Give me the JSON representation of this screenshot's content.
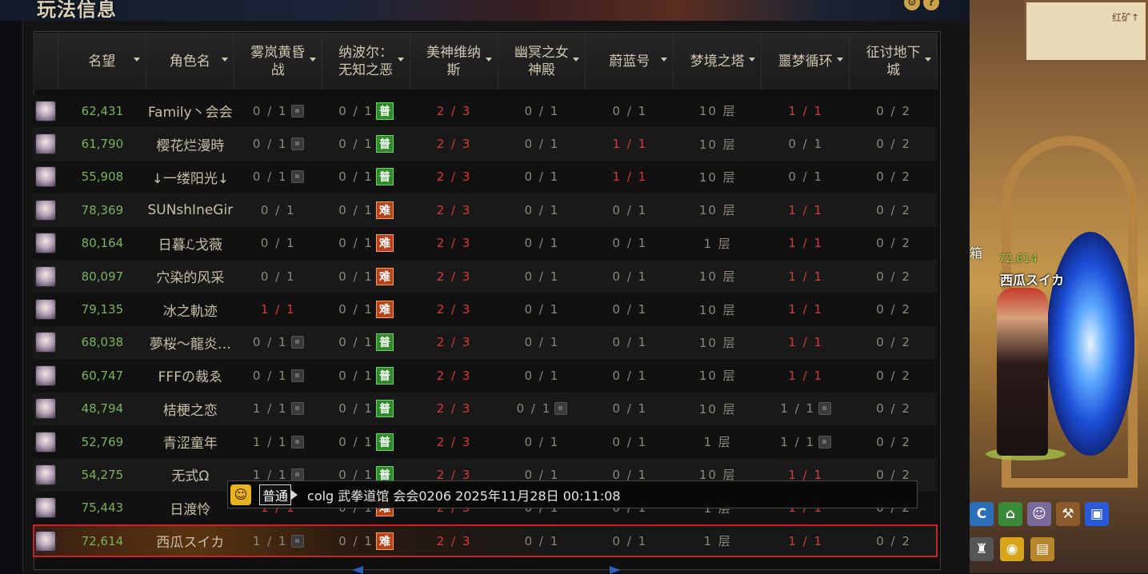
{
  "panel": {
    "title": "玩法信息"
  },
  "header": {
    "columns": [
      {
        "label": "名望"
      },
      {
        "label": "角色名"
      },
      {
        "label": "雾岚黄昏战"
      },
      {
        "label": "纳波尔：无知之恶"
      },
      {
        "label": "美神维纳斯"
      },
      {
        "label": "幽冥之女神殿"
      },
      {
        "label": "蔚蓝号"
      },
      {
        "label": "梦境之塔"
      },
      {
        "label": "噩梦循环"
      },
      {
        "label": "征讨地下城"
      }
    ]
  },
  "badges": {
    "normal": "普",
    "hard": "难"
  },
  "rows": [
    {
      "fame": "62,431",
      "name": "Family丶会会",
      "c1": "0 / 1",
      "c1_lock": true,
      "c2": "0 / 1",
      "c2_badge": "normal",
      "c3": "2 / 3",
      "c3_red": true,
      "c4": "0 / 1",
      "c4_lock": false,
      "c5": "0 / 1",
      "c5_red": false,
      "c6": "10 层",
      "c7": "1 / 1",
      "c7_red": true,
      "c7_lock": false,
      "c8": "0 / 2"
    },
    {
      "fame": "61,790",
      "name": "樱花烂漫時",
      "c1": "0 / 1",
      "c1_lock": true,
      "c2": "0 / 1",
      "c2_badge": "normal",
      "c3": "2 / 3",
      "c3_red": true,
      "c4": "0 / 1",
      "c4_lock": false,
      "c5": "1 / 1",
      "c5_red": true,
      "c6": "10 层",
      "c7": "0 / 1",
      "c7_red": false,
      "c7_lock": false,
      "c8": "0 / 2"
    },
    {
      "fame": "55,908",
      "name": "↓一缕阳光↓",
      "c1": "0 / 1",
      "c1_lock": true,
      "c2": "0 / 1",
      "c2_badge": "normal",
      "c3": "2 / 3",
      "c3_red": true,
      "c4": "0 / 1",
      "c4_lock": false,
      "c5": "1 / 1",
      "c5_red": true,
      "c6": "10 层",
      "c7": "0 / 1",
      "c7_red": false,
      "c7_lock": false,
      "c8": "0 / 2"
    },
    {
      "fame": "78,369",
      "name": "SUNshⅠneGir",
      "c1": "0 / 1",
      "c1_lock": false,
      "c2": "0 / 1",
      "c2_badge": "hard",
      "c3": "2 / 3",
      "c3_red": true,
      "c4": "0 / 1",
      "c4_lock": false,
      "c5": "0 / 1",
      "c5_red": false,
      "c6": "10 层",
      "c7": "1 / 1",
      "c7_red": true,
      "c7_lock": false,
      "c8": "0 / 2"
    },
    {
      "fame": "80,164",
      "name": "日暮ℒ戈薇",
      "c1": "0 / 1",
      "c1_lock": false,
      "c2": "0 / 1",
      "c2_badge": "hard",
      "c3": "2 / 3",
      "c3_red": true,
      "c4": "0 / 1",
      "c4_lock": false,
      "c5": "0 / 1",
      "c5_red": false,
      "c6": "1 层",
      "c7": "1 / 1",
      "c7_red": true,
      "c7_lock": false,
      "c8": "0 / 2"
    },
    {
      "fame": "80,097",
      "name": "穴染的风采",
      "c1": "0 / 1",
      "c1_lock": false,
      "c2": "0 / 1",
      "c2_badge": "hard",
      "c3": "2 / 3",
      "c3_red": true,
      "c4": "0 / 1",
      "c4_lock": false,
      "c5": "0 / 1",
      "c5_red": false,
      "c6": "10 层",
      "c7": "1 / 1",
      "c7_red": true,
      "c7_lock": false,
      "c8": "0 / 2"
    },
    {
      "fame": "79,135",
      "name": "冰之軌迹",
      "c1": "1 / 1",
      "c1_lock": false,
      "c1_red": true,
      "c2": "0 / 1",
      "c2_badge": "hard",
      "c3": "2 / 3",
      "c3_red": true,
      "c4": "0 / 1",
      "c4_lock": false,
      "c5": "0 / 1",
      "c5_red": false,
      "c6": "10 层",
      "c7": "1 / 1",
      "c7_red": true,
      "c7_lock": false,
      "c8": "0 / 2"
    },
    {
      "fame": "68,038",
      "name": "夢桜～龍炎…",
      "c1": "0 / 1",
      "c1_lock": true,
      "c2": "0 / 1",
      "c2_badge": "normal",
      "c3": "2 / 3",
      "c3_red": true,
      "c4": "0 / 1",
      "c4_lock": false,
      "c5": "0 / 1",
      "c5_red": false,
      "c6": "10 层",
      "c7": "1 / 1",
      "c7_red": true,
      "c7_lock": false,
      "c8": "0 / 2"
    },
    {
      "fame": "60,747",
      "name": "FFFの裁ゑ",
      "c1": "0 / 1",
      "c1_lock": true,
      "c2": "0 / 1",
      "c2_badge": "normal",
      "c3": "2 / 3",
      "c3_red": true,
      "c4": "0 / 1",
      "c4_lock": false,
      "c5": "0 / 1",
      "c5_red": false,
      "c6": "10 层",
      "c7": "1 / 1",
      "c7_red": true,
      "c7_lock": false,
      "c8": "0 / 2"
    },
    {
      "fame": "48,794",
      "name": "桔梗之恋",
      "c1": "1 / 1",
      "c1_lock": true,
      "c2": "0 / 1",
      "c2_badge": "normal",
      "c3": "2 / 3",
      "c3_red": true,
      "c4": "0 / 1",
      "c4_lock": true,
      "c5": "0 / 1",
      "c5_red": false,
      "c6": "10 层",
      "c7": "1 / 1",
      "c7_red": false,
      "c7_lock": true,
      "c8": "0 / 2"
    },
    {
      "fame": "52,769",
      "name": "青涩童年",
      "c1": "1 / 1",
      "c1_lock": true,
      "c2": "0 / 1",
      "c2_badge": "normal",
      "c3": "2 / 3",
      "c3_red": true,
      "c4": "0 / 1",
      "c4_lock": false,
      "c5": "0 / 1",
      "c5_red": false,
      "c6": "1 层",
      "c7": "1 / 1",
      "c7_red": false,
      "c7_lock": true,
      "c8": "0 / 2"
    },
    {
      "fame": "54,275",
      "name": "无式Ω",
      "c1": "1 / 1",
      "c1_lock": true,
      "c2": "0 / 1",
      "c2_badge": "normal",
      "c3": "2 / 3",
      "c3_red": true,
      "c4": "0 / 1",
      "c4_lock": false,
      "c5": "0 / 1",
      "c5_red": false,
      "c6": "10 层",
      "c7": "1 / 1",
      "c7_red": true,
      "c7_lock": false,
      "c8": "0 / 2"
    },
    {
      "fame": "75,443",
      "name": "日渡怜",
      "c1": "1 / 1",
      "c1_lock": false,
      "c1_red": true,
      "c2": "0 / 1",
      "c2_badge": "hard",
      "c3": "2 / 3",
      "c3_red": true,
      "c4": "0 / 1",
      "c4_lock": false,
      "c5": "0 / 1",
      "c5_red": false,
      "c6": "1 层",
      "c7": "1 / 1",
      "c7_red": true,
      "c7_lock": false,
      "c8": "0 / 2"
    },
    {
      "fame": "72,614",
      "name": "西瓜スイカ",
      "c1": "1 / 1",
      "c1_lock": true,
      "c2": "0 / 1",
      "c2_badge": "hard",
      "c3": "2 / 3",
      "c3_red": true,
      "c4": "0 / 1",
      "c4_lock": false,
      "c5": "0 / 1",
      "c5_red": false,
      "c6": "1 层",
      "c7": "1 / 1",
      "c7_red": true,
      "c7_lock": false,
      "c8": "0 / 2",
      "selected": true
    }
  ],
  "chat": {
    "emote": "☺",
    "channel": "普通",
    "text": "colg 武拳道馆 会会0206 2025年11月28日 00:11:08"
  },
  "scene": {
    "panel_text": "红矿↑",
    "side_text": "箱",
    "char_fame": "72,614",
    "char_name": "西瓜スイカ",
    "toolbar": [
      "C",
      "⌂",
      "☺",
      "⚒",
      "▣"
    ],
    "toolbar2": [
      "♜",
      "◉",
      "▤"
    ]
  }
}
